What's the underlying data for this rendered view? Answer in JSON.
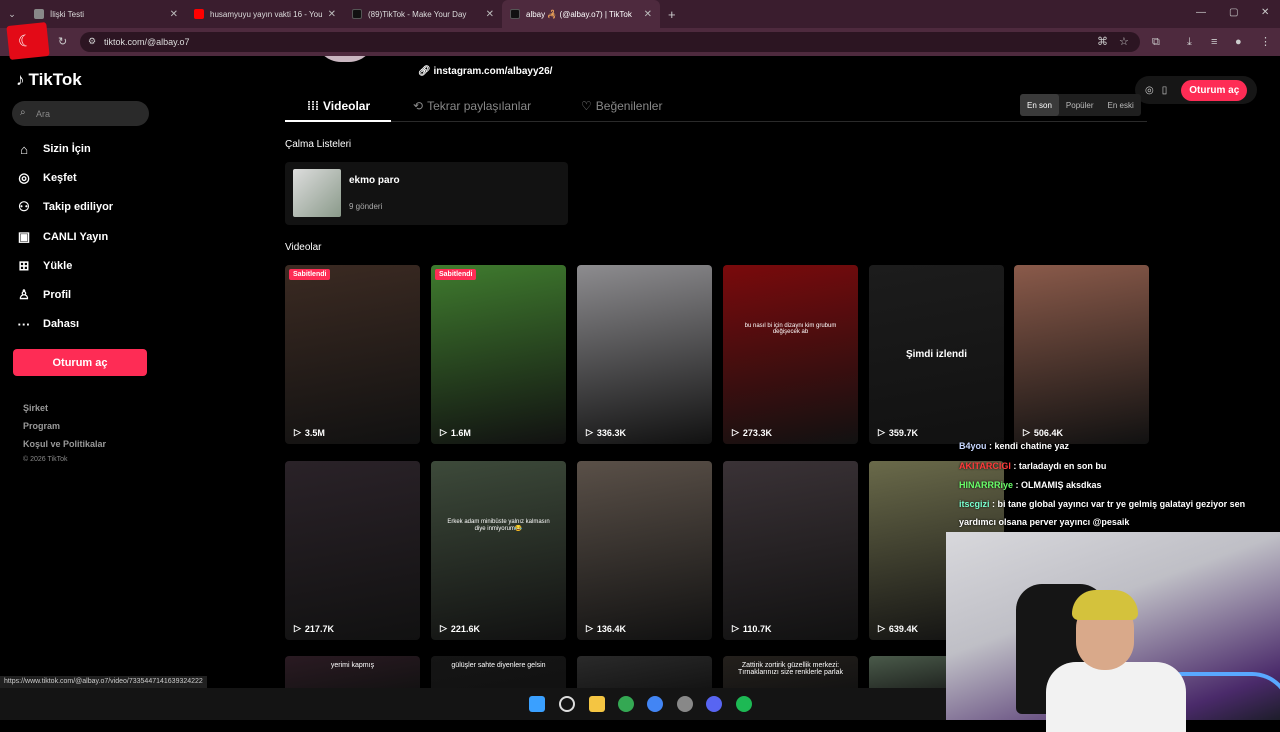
{
  "browser": {
    "tabs": [
      {
        "title": "İlişki Testi",
        "active": false
      },
      {
        "title": "husamyuyu yayın vakti 16 - You",
        "active": false
      },
      {
        "title": "(89)TikTok - Make Your Day",
        "active": false
      },
      {
        "title": "albay 🦂 (@albay.o7) | TikTok",
        "active": true
      }
    ],
    "new_tab": "+",
    "url": "tiktok.com/@albay.o7",
    "status_url": "https://www.tiktok.com/@albay.o7/video/7335447141639324222"
  },
  "sidebar": {
    "logo": "TikTok",
    "search_placeholder": "Ara",
    "nav": [
      {
        "label": "Sizin İçin",
        "icon": "home-icon",
        "glyph": "⌂"
      },
      {
        "label": "Keşfet",
        "icon": "compass-icon",
        "glyph": "◎"
      },
      {
        "label": "Takip ediliyor",
        "icon": "following-icon",
        "glyph": "⚇"
      },
      {
        "label": "CANLI Yayın",
        "icon": "live-icon",
        "glyph": "▣"
      },
      {
        "label": "Yükle",
        "icon": "upload-icon",
        "glyph": "⊞"
      },
      {
        "label": "Profil",
        "icon": "profile-icon",
        "glyph": "♙"
      },
      {
        "label": "Dahası",
        "icon": "more-icon",
        "glyph": "···"
      }
    ],
    "login": "Oturum aç",
    "footer": [
      "Şirket",
      "Program",
      "Koşul ve Politikalar"
    ],
    "copyright": "© 2026 TikTok"
  },
  "profile": {
    "link": "instagram.com/albayy26/",
    "tabs": [
      "Videolar",
      "Tekrar paylaşılanlar",
      "Beğenilenler"
    ],
    "sort": [
      "En son",
      "Popüler",
      "En eski"
    ],
    "sort_selected": "En son",
    "login": "Oturum aç",
    "playlists_title": "Çalma Listeleri",
    "playlist": {
      "name": "ekmo paro",
      "count": "9 gönderi"
    },
    "videos_title": "Videolar",
    "pinned_label": "Sabitlendi",
    "videos_row1": [
      {
        "views": "3.5M",
        "pinned": true,
        "caption": "",
        "color": "#3b2a22"
      },
      {
        "views": "1.6M",
        "pinned": true,
        "caption": "",
        "color": "#3f7b2e"
      },
      {
        "views": "336.3K",
        "pinned": false,
        "caption": "",
        "color": "#8d8c8f"
      },
      {
        "views": "273.3K",
        "pinned": false,
        "caption": "bu nasıl bi için dizaynı kim grubum değişecek ab",
        "color": "#7a0a0c"
      },
      {
        "views": "359.7K",
        "pinned": false,
        "caption": "",
        "color": "#1c1c1c",
        "watched": "Şimdi izlendi"
      },
      {
        "views": "506.4K",
        "pinned": false,
        "caption": "",
        "color": "#8a5a4a"
      }
    ],
    "videos_row2": [
      {
        "views": "217.7K",
        "caption": "",
        "color": "#2a2228"
      },
      {
        "views": "221.6K",
        "caption": "Erkek adam minibüste yalnız kalmasın diye inmiyorum😂",
        "color": "#3d4a3a"
      },
      {
        "views": "136.4K",
        "caption": "",
        "color": "#5a5048"
      },
      {
        "views": "110.7K",
        "caption": "",
        "color": "#3a3236"
      },
      {
        "views": "639.4K",
        "caption": "",
        "color": "#6a6a4a"
      }
    ],
    "videos_row3": [
      {
        "caption": "yerimi kapmış",
        "color": "#2a1a22"
      },
      {
        "caption": "gülüşler sahte diyenlere gelsin",
        "color": "#151515"
      },
      {
        "caption": "",
        "color": "#2a2a2a"
      },
      {
        "caption": "Zattirik zortirik güzellik merkezi: Tırnaklarınızı size renklerle parlak",
        "color": "#24201c"
      },
      {
        "caption": "",
        "color": "#4a5a4a"
      }
    ]
  },
  "chat": [
    {
      "user": "B4you",
      "msg": "kendi chatine yaz",
      "color": "#c8d8ff"
    },
    {
      "user": "AKITARCIGI",
      "msg": "tarladaydı en son bu",
      "color": "#ff3a3a"
    },
    {
      "user": "HINARRRiye",
      "msg": "OLMAMIŞ aksdkas",
      "color": "#6aff6a"
    },
    {
      "user": "itscgizi",
      "msg": "bi tane global yayıncı var tr ye gelmiş galatayi geziyor sen",
      "color": "#7affd0"
    },
    {
      "user": "",
      "msg": "yardımcı olsana perver yayıncı @pesaik",
      "color": "#ffffff"
    }
  ],
  "colors": {
    "accent": "#fe2c55",
    "tab_bar": "#3a1d2e"
  }
}
